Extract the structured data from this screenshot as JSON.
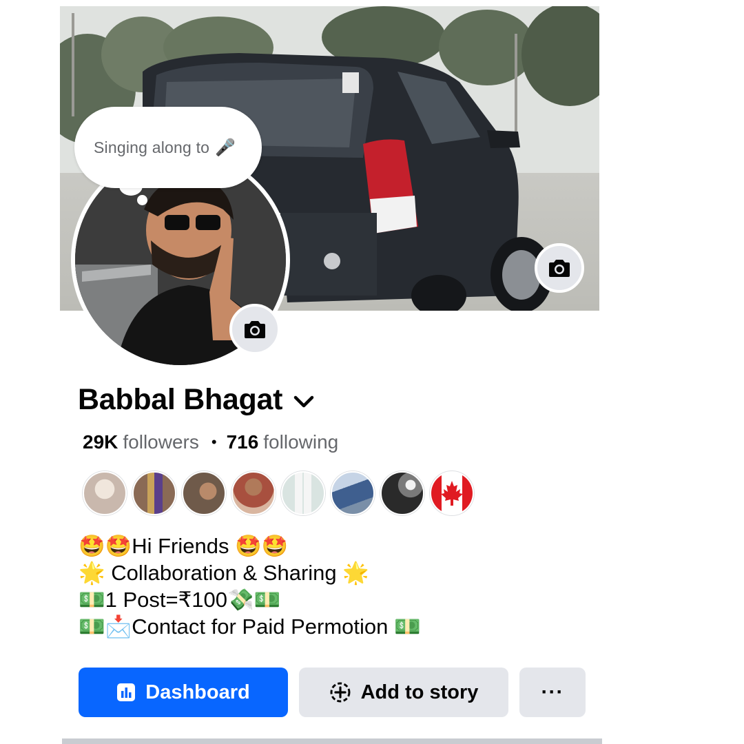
{
  "profile": {
    "name": "Babbal Bhagat",
    "note": "Singing along to",
    "note_icon": "🎤",
    "followers_count": "29K",
    "followers_label": "followers",
    "separator": "•",
    "following_count": "716",
    "following_label": "following"
  },
  "friends": [
    {
      "icon": "friend-avatar-1",
      "color": "#c9b8ad"
    },
    {
      "icon": "friend-avatar-2",
      "color": "#8a6a55"
    },
    {
      "icon": "friend-avatar-3",
      "color": "#6f5a4a"
    },
    {
      "icon": "friend-avatar-4",
      "color": "#a8503f"
    },
    {
      "icon": "friend-avatar-5",
      "color": "#d9e4e1"
    },
    {
      "icon": "friend-avatar-6",
      "color": "#3f5f8f"
    },
    {
      "icon": "friend-avatar-7",
      "color": "#2a2a2a"
    },
    {
      "icon": "canada-flag-icon",
      "color": "#e01b22"
    }
  ],
  "bio": {
    "line1": "🤩🤩Hi Friends 🤩🤩",
    "line2": "🌟 Collaboration & Sharing 🌟",
    "line3": "💵1 Post=₹100💸💵",
    "line4": "💵📩Contact for Paid Permotion 💵"
  },
  "buttons": {
    "dashboard": "Dashboard",
    "add_story": "Add to story",
    "more": "···"
  },
  "colors": {
    "primary": "#0866ff",
    "secondary_bg": "#e4e6eb",
    "text": "#050505",
    "muted": "#65676b"
  }
}
